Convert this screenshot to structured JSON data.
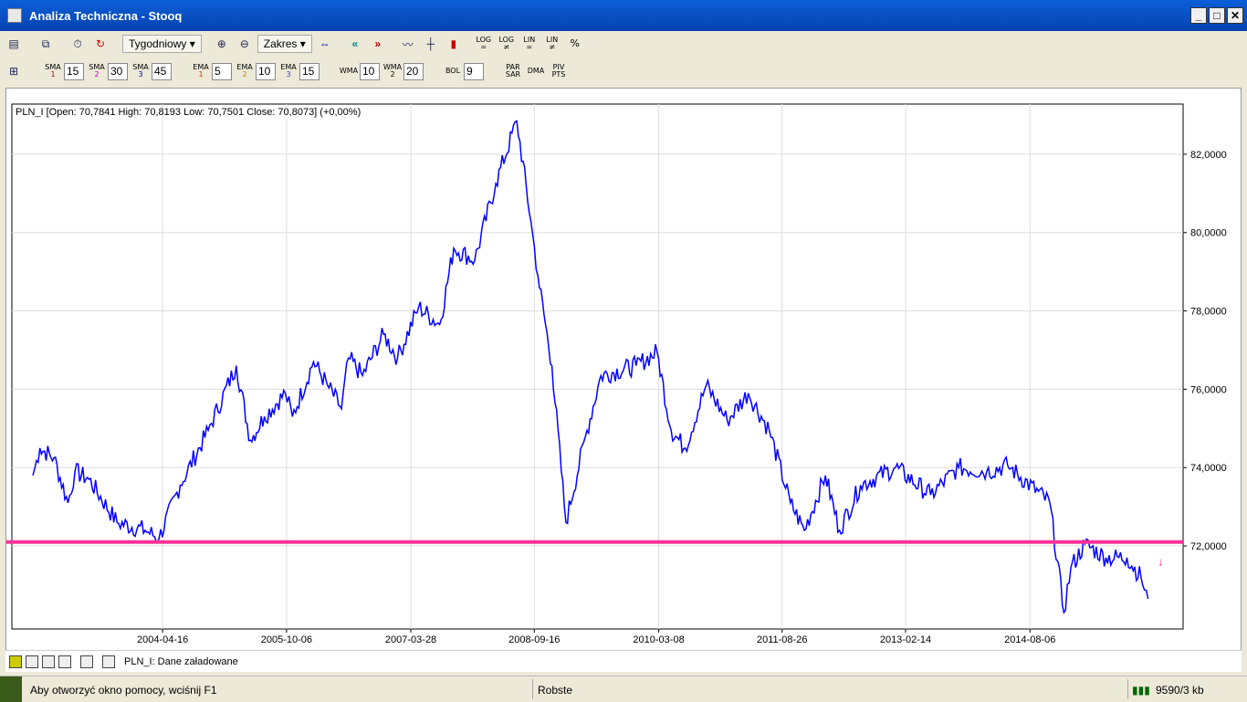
{
  "window": {
    "title": "Analiza Techniczna - Stooq",
    "min": "_",
    "max": "□",
    "close": "✕"
  },
  "toolbar1": {
    "period": "Tygodniowy",
    "range": "Zakres",
    "log_eq": "LOG =",
    "log_ne": "LOG ≠",
    "lin_eq": "LIN =",
    "lin_ne": "LIN ≠",
    "pct": "%"
  },
  "toolbar2": {
    "indicators": [
      {
        "label": "SMA",
        "sub": "1",
        "value": "15",
        "color": "#c00000"
      },
      {
        "label": "SMA",
        "sub": "2",
        "value": "30",
        "color": "#c000c0"
      },
      {
        "label": "SMA",
        "sub": "3",
        "value": "45",
        "color": "#0000c0"
      },
      {
        "label": "EMA",
        "sub": "1",
        "value": "5",
        "color": "#c04000"
      },
      {
        "label": "EMA",
        "sub": "2",
        "value": "10",
        "color": "#c08000"
      },
      {
        "label": "EMA",
        "sub": "3",
        "value": "15",
        "color": "#4040c0"
      },
      {
        "label": "WMA",
        "sub": "",
        "value": "10",
        "color": "#000"
      },
      {
        "label": "WMA",
        "sub": "2",
        "value": "20",
        "color": "#000"
      },
      {
        "label": "BOL",
        "sub": "",
        "value": "9",
        "color": "#000"
      }
    ],
    "par_sar": "PAR SAR",
    "dma": "DMA",
    "piv_pts": "PIV PTS"
  },
  "chart_header": "PLN_I [Open: 70,7841  High: 70,8193  Low: 70,7501  Close: 70,8073] (+0,00%)",
  "chart_data": {
    "type": "line",
    "title": "PLN_I",
    "line_color": "#0000ff",
    "xlim": [
      "2002-07",
      "2016-06"
    ],
    "ylim": [
      69.88,
      83.28
    ],
    "xticks": [
      "2004-04-16",
      "2005-10-06",
      "2007-03-28",
      "2008-09-16",
      "2010-03-08",
      "2011-08-26",
      "2013-02-14",
      "2014-08-06"
    ],
    "yticks": [
      "72,0000",
      "74,0000",
      "76,0000",
      "78,0000",
      "80,0000",
      "82,0000"
    ],
    "ytick_values": [
      72,
      74,
      76,
      78,
      80,
      82
    ],
    "grid": true,
    "hline": {
      "value": 72.1,
      "color": "#ff3399"
    },
    "series": [
      {
        "x": [
          "2002-10",
          "2002-11",
          "2003-01",
          "2003-03",
          "2003-04",
          "2003-06",
          "2003-10",
          "2004-02",
          "2004-04",
          "2004-07",
          "2004-11",
          "2005-03",
          "2005-05",
          "2005-07",
          "2005-10",
          "2005-11",
          "2006-02",
          "2006-04",
          "2006-06",
          "2006-07",
          "2006-09",
          "2006-12",
          "2007-02",
          "2007-05",
          "2007-08",
          "2007-10",
          "2008-01",
          "2008-04",
          "2008-07",
          "2008-09",
          "2008-10",
          "2008-12",
          "2009-02",
          "2009-05",
          "2009-07",
          "2009-12",
          "2010-03",
          "2010-05",
          "2010-07",
          "2010-10",
          "2011-01",
          "2011-04",
          "2011-07",
          "2011-10",
          "2011-12",
          "2012-03",
          "2012-05",
          "2012-08",
          "2013-01",
          "2013-06",
          "2013-10",
          "2014-02",
          "2014-05",
          "2014-11",
          "2015-01",
          "2015-02",
          "2015-04",
          "2015-07",
          "2015-10",
          "2015-12",
          "2016-01"
        ],
        "values": [
          73.8,
          74.5,
          74.25,
          73.1,
          73.9,
          73.7,
          72.6,
          72.4,
          72.2,
          73.55,
          74.95,
          76.6,
          74.7,
          75.3,
          75.9,
          75.3,
          76.7,
          76.1,
          75.5,
          76.8,
          76.35,
          77.4,
          76.8,
          78.1,
          77.65,
          79.6,
          79.3,
          81.25,
          82.85,
          80.3,
          78.9,
          76.6,
          72.6,
          74.95,
          76.35,
          76.6,
          76.95,
          74.95,
          74.5,
          76.1,
          75.2,
          75.9,
          74.95,
          73.1,
          72.4,
          73.8,
          72.4,
          73.55,
          74.0,
          73.3,
          74.0,
          73.9,
          74.05,
          73.1,
          70.3,
          71.45,
          72.05,
          71.7,
          71.7,
          71.2,
          70.65
        ]
      }
    ]
  },
  "bottom": {
    "status": "PLN_I: Dane załadowane"
  },
  "statusbar": {
    "help": "Aby otworzyć okno pomocy, wciśnij F1",
    "mode": "Robste",
    "memory": "9590/3 kb"
  }
}
